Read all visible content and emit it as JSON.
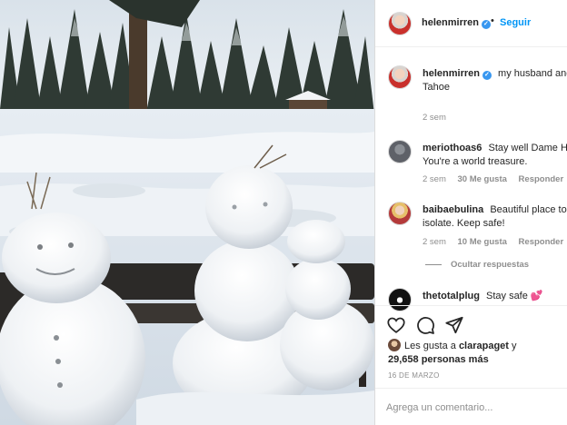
{
  "post": {
    "photo_icon": "snowmen-photo",
    "author": {
      "username": "helenmirren",
      "verified": true,
      "separator": "•",
      "follow_label": "Seguir"
    },
    "caption": {
      "username": "helenmirren",
      "text": "my husband and I self isolating at Lake",
      "text_line2": "Tahoe",
      "time": "2 sem"
    }
  },
  "comments": [
    {
      "username": "meriothoas6",
      "line1": "Stay well Dame Helen",
      "line2": "You're a world treasure.",
      "time": "2 sem",
      "likes": "30 Me gusta",
      "reply": "Responder"
    },
    {
      "username": "baibaebulina",
      "line1": "Beautiful place to",
      "line2": "isolate. Keep safe!",
      "time": "2 sem",
      "likes": "10 Me gusta",
      "reply": "Responder"
    }
  ],
  "hide_replies": "Ocultar respuestas",
  "last_comment": {
    "username": "thetotalplug",
    "text": "Stay safe",
    "emoji": "💕"
  },
  "actions": {
    "like_icon": "heart-icon",
    "comment_icon": "comment-icon",
    "share_icon": "share-icon"
  },
  "likes": {
    "prefix": "Les gusta a",
    "user": "clarapaget",
    "joiner": "y",
    "count": "29,658 personas más"
  },
  "date": "16 DE MARZO",
  "add_comment": {
    "placeholder": "Agrega un comentario..."
  },
  "colors": {
    "link": "#0095f6",
    "verified": "#3897f0",
    "muted": "#8e8e8e",
    "text": "#262626"
  }
}
